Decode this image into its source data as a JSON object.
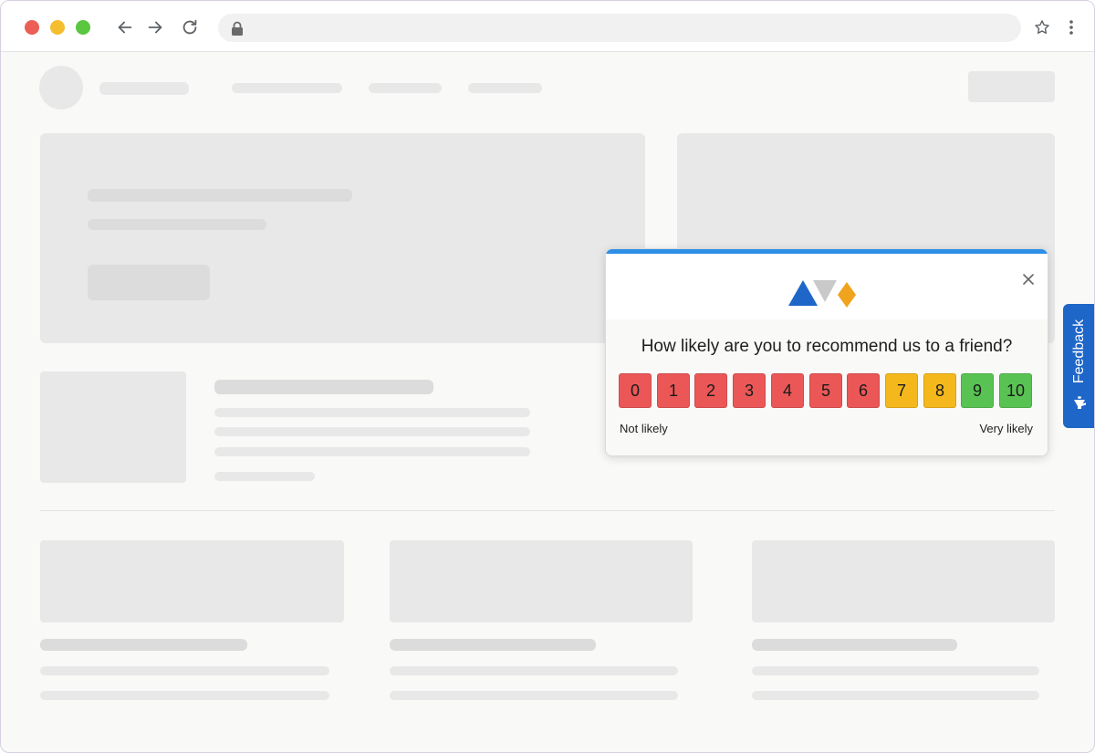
{
  "browser": {
    "address_value": "",
    "icons": [
      "back-arrow-icon",
      "forward-arrow-icon",
      "reload-icon",
      "lock-icon",
      "star-icon",
      "menu-icon"
    ]
  },
  "nps": {
    "question": "How likely are you to recommend us to a friend?",
    "scores": [
      {
        "label": "0",
        "color": "#eb5757"
      },
      {
        "label": "1",
        "color": "#eb5757"
      },
      {
        "label": "2",
        "color": "#eb5757"
      },
      {
        "label": "3",
        "color": "#eb5757"
      },
      {
        "label": "4",
        "color": "#eb5757"
      },
      {
        "label": "5",
        "color": "#eb5757"
      },
      {
        "label": "6",
        "color": "#eb5757"
      },
      {
        "label": "7",
        "color": "#f5b81c"
      },
      {
        "label": "8",
        "color": "#f5b81c"
      },
      {
        "label": "9",
        "color": "#58c353"
      },
      {
        "label": "10",
        "color": "#58c353"
      }
    ],
    "low_label": "Not likely",
    "high_label": "Very likely",
    "accent_color": "#2d8fe6",
    "logo_colors": [
      "#1e66c8",
      "#c9c9c9",
      "#f0a31c"
    ]
  },
  "feedback_tab": {
    "label": "Feedback",
    "color": "#1e66c8",
    "icon": "megaphone-icon"
  }
}
